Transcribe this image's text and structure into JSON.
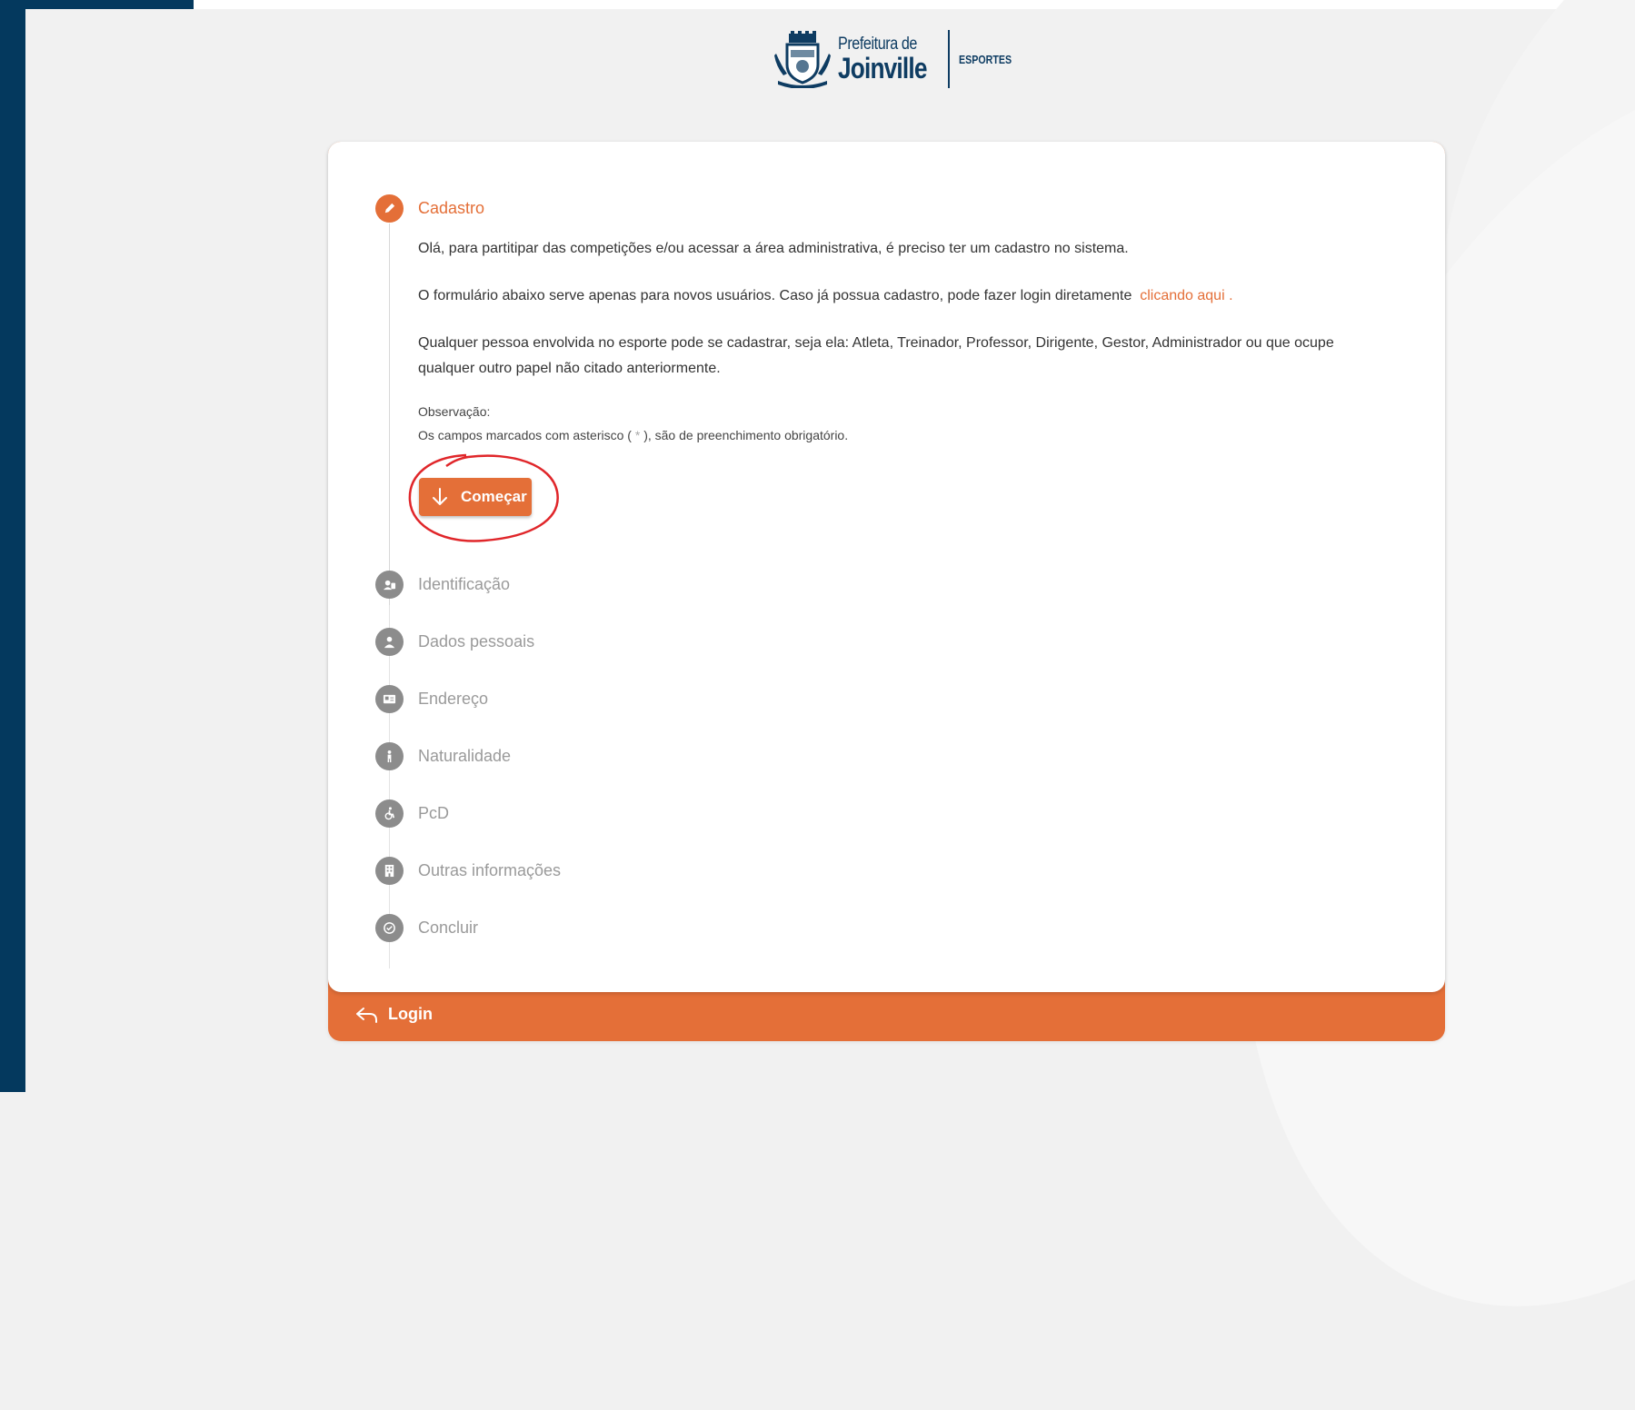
{
  "header": {
    "logo_line1": "Prefeitura de",
    "logo_line2": "Joinville",
    "logo_tag": "ESPORTES"
  },
  "intro": {
    "step_title": "Cadastro",
    "paragraph1": "Olá, para partitipar das competições e/ou acessar a área administrativa, é preciso ter um cadastro no sistema.",
    "paragraph2_before": "O formulário abaixo serve apenas para novos usuários. Caso já possua cadastro, pode fazer login diretamente",
    "paragraph2_link": "clicando aqui",
    "paragraph2_after": ".",
    "paragraph3": "Qualquer pessoa envolvida no esporte pode se cadastrar, seja ela: Atleta, Treinador, Professor, Dirigente, Gestor, Administrador ou que ocupe qualquer outro papel não citado anteriormente.",
    "obs_title": "Observação:",
    "obs_text_before": "Os campos marcados com asterisco (",
    "obs_asterisk": "*",
    "obs_text_after": "), são de preenchimento obrigatório.",
    "start_button": "Começar"
  },
  "steps": [
    {
      "label": "Identificação",
      "icon": "id-badge-icon"
    },
    {
      "label": "Dados pessoais",
      "icon": "person-icon"
    },
    {
      "label": "Endereço",
      "icon": "address-card-icon"
    },
    {
      "label": "Naturalidade",
      "icon": "child-icon"
    },
    {
      "label": "PcD",
      "icon": "wheelchair-icon"
    },
    {
      "label": "Outras informações",
      "icon": "building-icon"
    },
    {
      "label": "Concluir",
      "icon": "check-circle-icon"
    }
  ],
  "footer": {
    "login_label": "Login"
  },
  "colors": {
    "accent": "#e46f38",
    "brand_blue": "#04395e",
    "inactive_step": "#8c8c8c"
  }
}
